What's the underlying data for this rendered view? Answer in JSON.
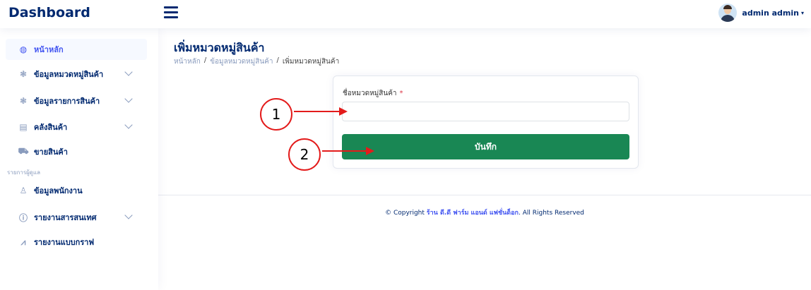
{
  "header": {
    "brand": "Dashboard",
    "user_name": "admin admin",
    "user_caret": "▾"
  },
  "sidebar": {
    "items": [
      {
        "label": "หน้าหลัก",
        "icon": "dashboard-icon",
        "glyph": "◍"
      },
      {
        "label": "ข้อมูลหมวดหมู่สินค้า",
        "icon": "paw-icon",
        "glyph": "❃"
      },
      {
        "label": "ข้อมูลรายการสินค้า",
        "icon": "paw-icon",
        "glyph": "❃"
      },
      {
        "label": "คลังสินค้า",
        "icon": "archive-icon",
        "glyph": "▤"
      },
      {
        "label": "ขายสินค้า",
        "icon": "cart-icon",
        "glyph": "⛟"
      },
      {
        "label": "ข้อมูลพนักงาน",
        "icon": "person-icon",
        "glyph": "♙"
      },
      {
        "label": "รายงานสารสนเทศ",
        "icon": "info-icon",
        "glyph": "ⓘ"
      },
      {
        "label": "รายงานแบบกราฟ",
        "icon": "graph-icon",
        "glyph": "⩘"
      }
    ],
    "heading": "รายการผู้ดูแล"
  },
  "main": {
    "page_title": "เพิ่มหมวดหมู่สินค้า",
    "breadcrumb": {
      "home": "หน้าหลัก",
      "category": "ข้อมูลหมวดหมู่สินค้า",
      "current": "เพิ่มหมวดหมู่สินค้า",
      "separator": "/"
    },
    "form": {
      "field_label": "ชื่อหมวดหมู่สินค้า",
      "required_mark": "*",
      "field_value": "",
      "field_placeholder": "",
      "save_label": "บันทึก"
    }
  },
  "footer": {
    "prefix": "© Copyright",
    "shop_name": "ร้าน ดี.ดี ฟาร์ม แอนด์ แฟชั่นด็อก",
    "suffix": ". All Rights Reserved"
  },
  "annotations": {
    "marker_1": "1",
    "marker_2": "2",
    "color": "#e31b1b"
  },
  "colors": {
    "primary": "#012970",
    "accent": "#4154f1",
    "save_button": "#198754",
    "required": "#dc3545"
  }
}
